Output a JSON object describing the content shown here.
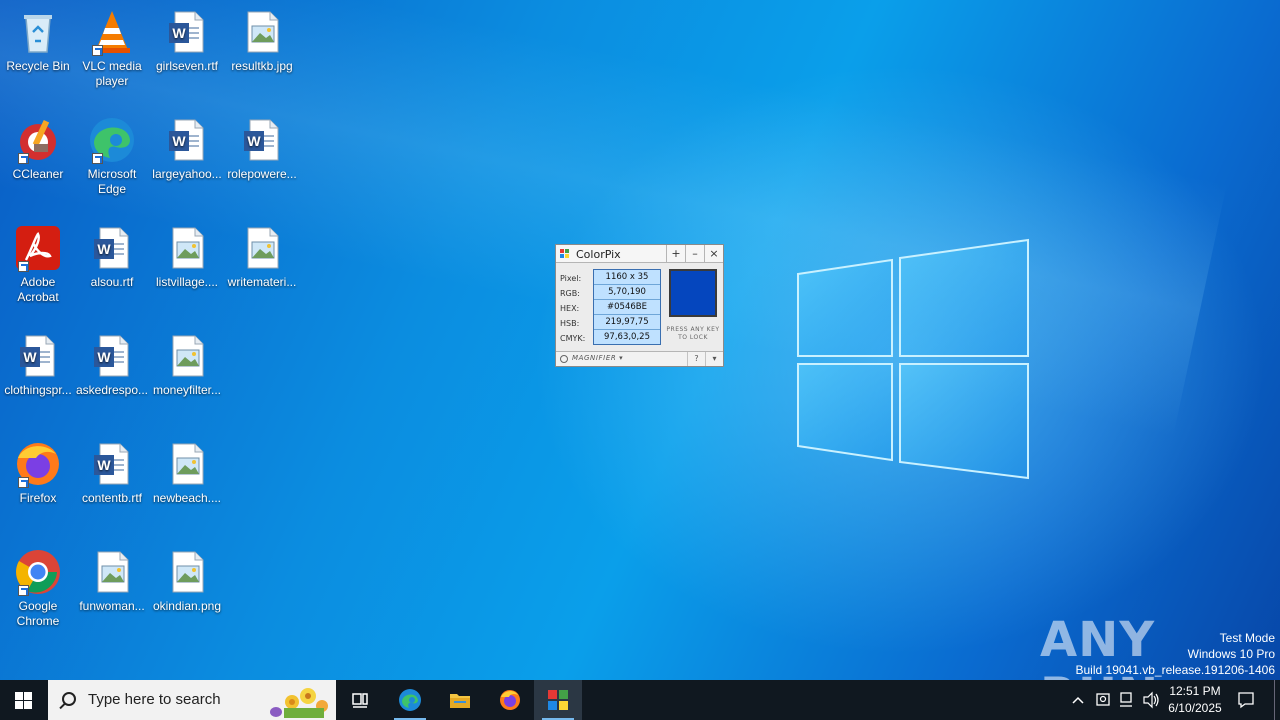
{
  "desktop": {
    "icons": [
      {
        "label": "Recycle Bin",
        "icon": "recycle-bin-icon"
      },
      {
        "label": "VLC media player",
        "icon": "vlc-icon"
      },
      {
        "label": "girlseven.rtf",
        "icon": "word-doc-icon"
      },
      {
        "label": "resultkb.jpg",
        "icon": "image-file-icon"
      },
      {
        "label": "CCleaner",
        "icon": "ccleaner-icon"
      },
      {
        "label": "Microsoft Edge",
        "icon": "edge-icon"
      },
      {
        "label": "largeyahoo...",
        "icon": "word-doc-icon"
      },
      {
        "label": "rolepowere...",
        "icon": "word-doc-icon"
      },
      {
        "label": "Adobe Acrobat",
        "icon": "acrobat-icon"
      },
      {
        "label": "alsou.rtf",
        "icon": "word-doc-icon"
      },
      {
        "label": "listvillage....",
        "icon": "image-file-icon"
      },
      {
        "label": "writemateri...",
        "icon": "image-file-icon"
      },
      {
        "label": "clothingspr...",
        "icon": "word-doc-icon"
      },
      {
        "label": "askedrespo...",
        "icon": "word-doc-icon"
      },
      {
        "label": "moneyfilter...",
        "icon": "image-file-icon"
      },
      {
        "label": "Firefox",
        "icon": "firefox-icon"
      },
      {
        "label": "contentb.rtf",
        "icon": "word-doc-icon"
      },
      {
        "label": "newbeach....",
        "icon": "image-file-icon"
      },
      {
        "label": "Google Chrome",
        "icon": "chrome-icon"
      },
      {
        "label": "funwoman...",
        "icon": "image-file-icon"
      },
      {
        "label": "okindian.png",
        "icon": "image-file-icon"
      }
    ]
  },
  "colorpix": {
    "title": "ColorPix",
    "title_buttons": {
      "pin": "+",
      "minimize": "–",
      "close": "×"
    },
    "labels": {
      "pixel": "Pixel:",
      "rgb": "RGB:",
      "hex": "HEX:",
      "hsb": "HSB:",
      "cmyk": "CMYK:"
    },
    "values": {
      "pixel": "1160 x 35",
      "rgb": "5,70,190",
      "hex": "#0546BE",
      "hsb": "219,97,75",
      "cmyk": "97,63,0,25"
    },
    "swatch_color": "#0546BE",
    "lock_hint": "PRESS ANY KEY TO LOCK",
    "magnifier_label": "MAGNIFIER ▾",
    "help_label": "?",
    "menu_label": "▾"
  },
  "watermark": {
    "brand": "ANY RUN",
    "line1": "Test Mode",
    "line2": "Windows 10 Pro",
    "line3": "Build 19041.vb_release.191206-1406"
  },
  "taskbar": {
    "search_placeholder": "Type here to search",
    "apps": [
      {
        "name": "task-view",
        "icon": "task-view-icon"
      },
      {
        "name": "edge",
        "icon": "edge-icon"
      },
      {
        "name": "file-explorer",
        "icon": "folder-icon"
      },
      {
        "name": "firefox",
        "icon": "firefox-icon"
      },
      {
        "name": "colorpix",
        "icon": "colorpix-icon",
        "active": true
      }
    ],
    "clock_time": "12:51 PM",
    "clock_date": "6/10/2025"
  },
  "colors": {
    "accent": "#0078d7",
    "taskbar": "#101820",
    "colorpix_value_bg": "#bfe1ff"
  }
}
